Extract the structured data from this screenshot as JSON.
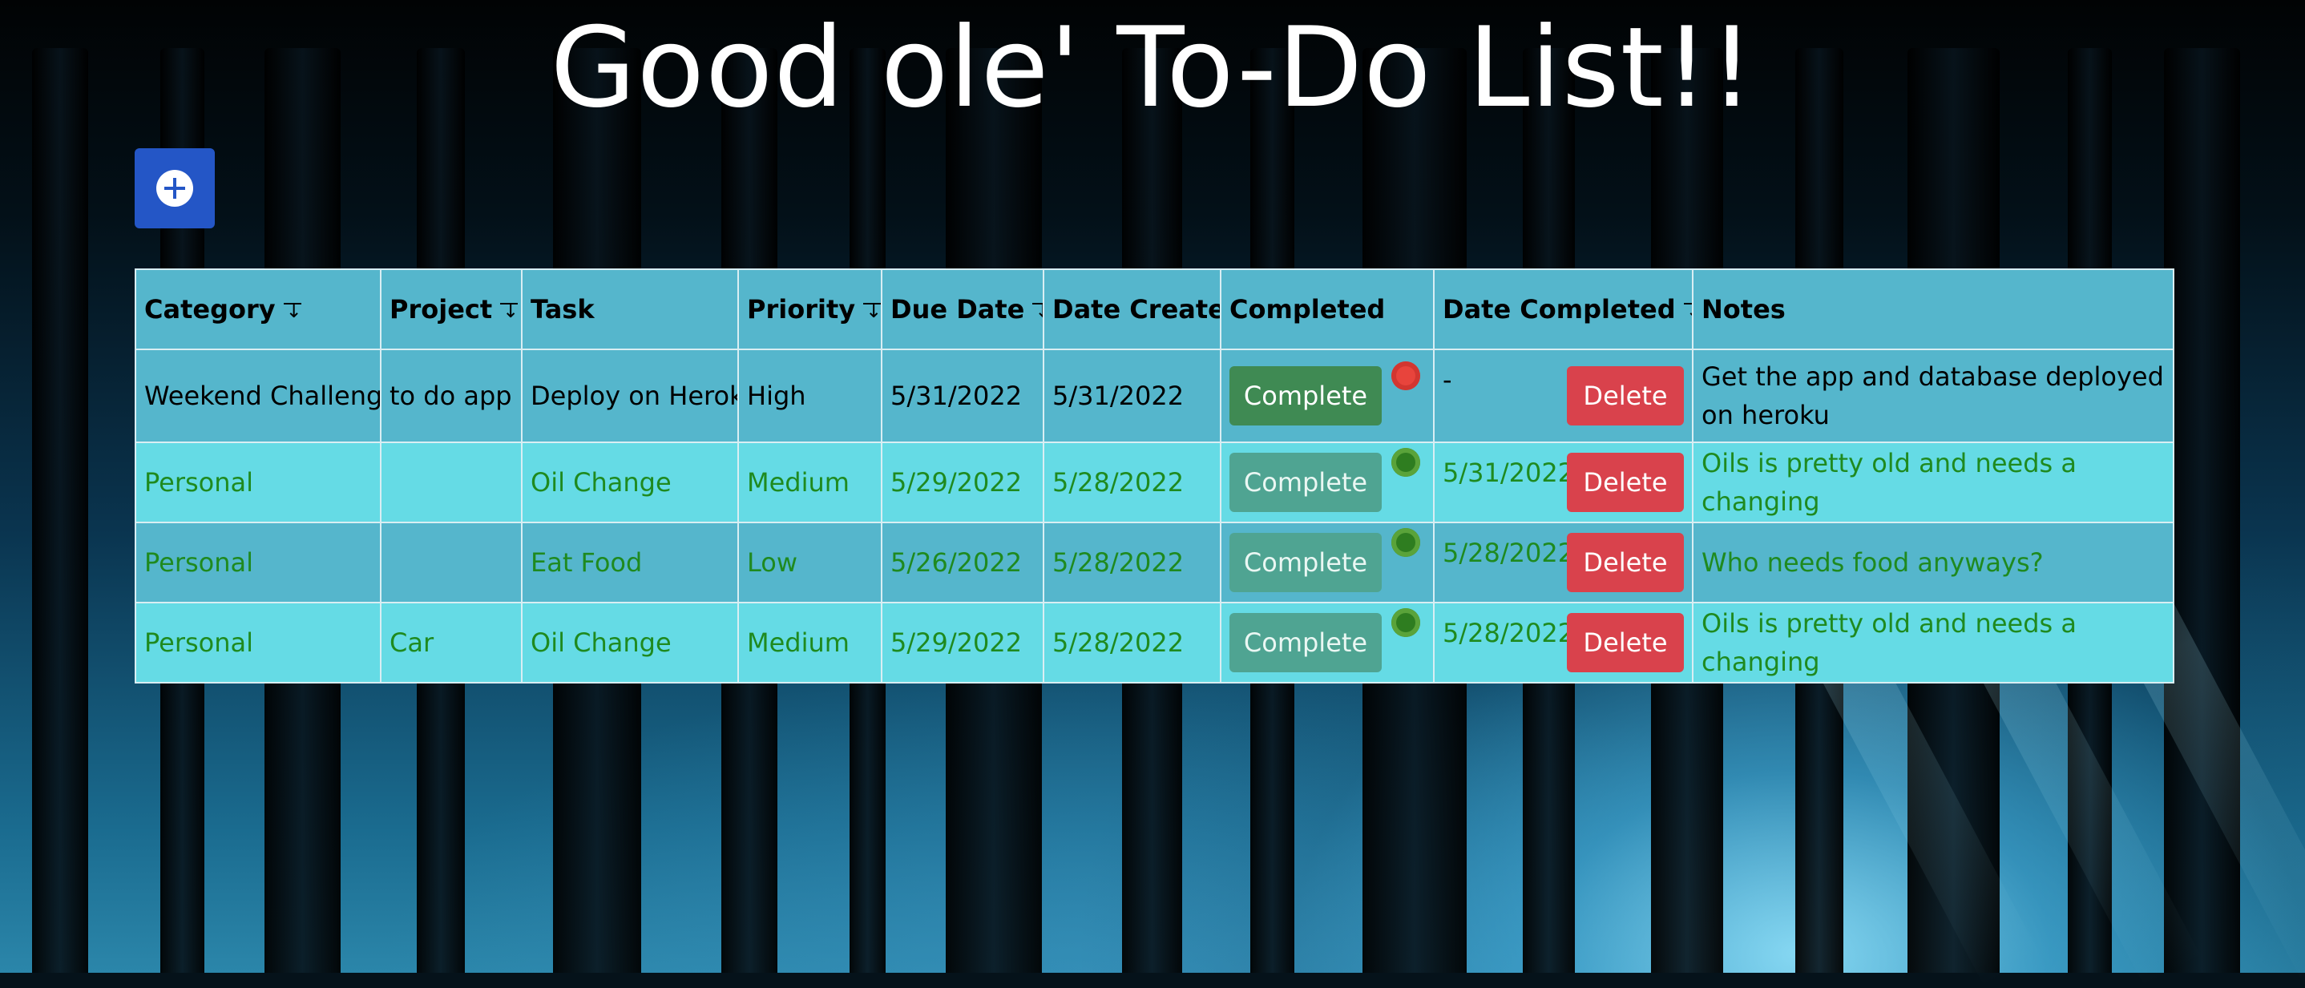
{
  "page": {
    "title": "Good ole' To-Do List!!",
    "add_button_icon": "plus-circle-icon"
  },
  "table": {
    "columns": [
      {
        "label": "Category",
        "sortable": true
      },
      {
        "label": "Project",
        "sortable": true
      },
      {
        "label": "Task",
        "sortable": false
      },
      {
        "label": "Priority",
        "sortable": true
      },
      {
        "label": "Due Date",
        "sortable": true
      },
      {
        "label": "Date Created",
        "sortable": false
      },
      {
        "label": "Completed",
        "sortable": false
      },
      {
        "label": "Date Completed",
        "sortable": true
      },
      {
        "label": "Notes",
        "sortable": false
      }
    ],
    "rows": [
      {
        "category": "Weekend Challenge",
        "project": "to do app",
        "task": "Deploy on Heroki",
        "priority": "High",
        "due_date": "5/31/2022",
        "date_created": "5/31/2022",
        "complete_label": "Complete",
        "completed": false,
        "date_completed": "-",
        "delete_label": "Delete",
        "notes": "Get the app and database deployed on heroku"
      },
      {
        "category": "Personal",
        "project": "",
        "task": "Oil Change",
        "priority": "Medium",
        "due_date": "5/29/2022",
        "date_created": "5/28/2022",
        "complete_label": "Complete",
        "completed": true,
        "date_completed": "5/31/2022",
        "delete_label": "Delete",
        "notes": "Oils is pretty old and needs a changing"
      },
      {
        "category": "Personal",
        "project": "",
        "task": "Eat Food",
        "priority": "Low",
        "due_date": "5/26/2022",
        "date_created": "5/28/2022",
        "complete_label": "Complete",
        "completed": true,
        "date_completed": "5/28/2022",
        "delete_label": "Delete",
        "notes": "Who needs food anyways?"
      },
      {
        "category": "Personal",
        "project": "Car",
        "task": "Oil Change",
        "priority": "Medium",
        "due_date": "5/29/2022",
        "date_created": "5/28/2022",
        "complete_label": "Complete",
        "completed": true,
        "date_completed": "5/28/2022",
        "delete_label": "Delete",
        "notes": "Oils is pretty old and needs a changing"
      }
    ]
  },
  "colors": {
    "header_bg": "#55b6cc",
    "row_alt_bg": "#65dbe5",
    "completed_text": "#1f8a1f",
    "add_button_bg": "#2456c6",
    "delete_bg": "#d9424c",
    "complete_active_bg": "#3f8a53",
    "complete_done_bg": "#4fa492",
    "status_incomplete": "#e8443c",
    "status_complete": "#2e7d20"
  }
}
